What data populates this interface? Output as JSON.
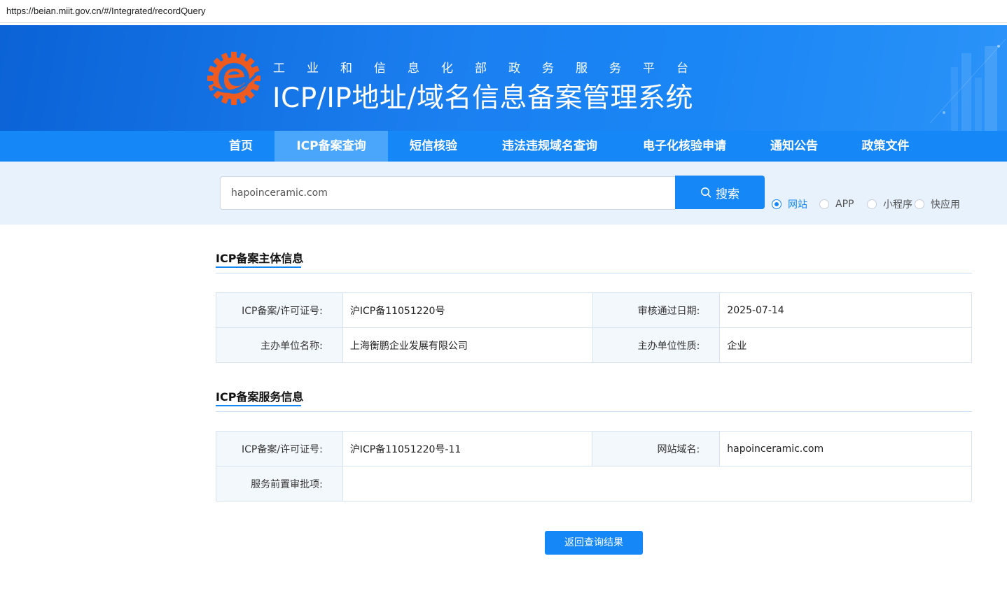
{
  "browser": {
    "url": "https://beian.miit.gov.cn/#/Integrated/recordQuery"
  },
  "header": {
    "subtitle": "工业和信息化部政务服务平台",
    "title": "ICP/IP地址/域名信息备案管理系统",
    "colors": {
      "primary": "#1687f6",
      "logo_orange": "#ef5a1f"
    }
  },
  "nav": {
    "items": [
      {
        "label": "首页"
      },
      {
        "label": "ICP备案查询",
        "active": true
      },
      {
        "label": "短信核验"
      },
      {
        "label": "违法违规域名查询"
      },
      {
        "label": "电子化核验申请"
      },
      {
        "label": "通知公告"
      },
      {
        "label": "政策文件"
      }
    ]
  },
  "search": {
    "value": "hapoinceramic.com",
    "button_label": "搜索",
    "icon": "search-icon",
    "types": [
      {
        "label": "网站",
        "checked": true
      },
      {
        "label": "APP",
        "checked": false
      },
      {
        "label": "小程序",
        "checked": false
      },
      {
        "label": "快应用",
        "checked": false
      }
    ]
  },
  "subject_info": {
    "title": "ICP备案主体信息",
    "rows": [
      {
        "k1": "ICP备案/许可证号:",
        "v1": "沪ICP备11051220号",
        "k2": "审核通过日期:",
        "v2": "2025-07-14"
      },
      {
        "k1": "主办单位名称:",
        "v1": "上海衡鹏企业发展有限公司",
        "k2": "主办单位性质:",
        "v2": "企业"
      }
    ]
  },
  "service_info": {
    "title": "ICP备案服务信息",
    "row1": {
      "k1": "ICP备案/许可证号:",
      "v1": "沪ICP备11051220号-11",
      "k2": "网站域名:",
      "v2": "hapoinceramic.com"
    },
    "row2": {
      "k1": "服务前置审批项:",
      "v1": ""
    }
  },
  "actions": {
    "back_label": "返回查询结果"
  }
}
